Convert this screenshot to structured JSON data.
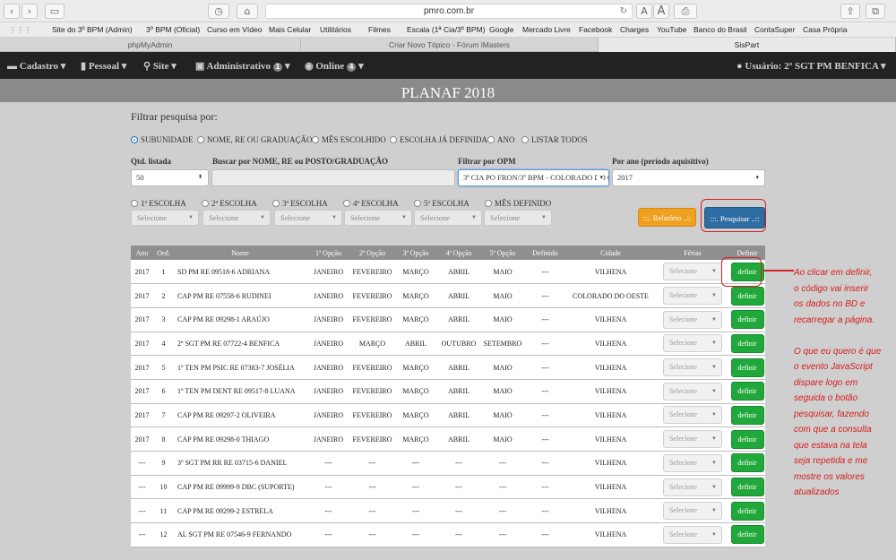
{
  "browser": {
    "url": "pmro.com.br",
    "reader_small": "A",
    "reader_large": "A",
    "bookmarks": [
      "Site do 3º BPM (Admin)",
      "3º BPM (Oficial)",
      "Curso em Vídeo",
      "Mais Celular",
      "Utilitários",
      "Filmes",
      "Escala (1ª Cia/3º BPM)",
      "Google",
      "Mercado Livre",
      "Facebook",
      "Charges",
      "YouTube",
      "Banco do Brasil",
      "ContaSuper",
      "Casa Própria"
    ],
    "tabs": [
      "phpMyAdmin",
      "Criar Novo Tópico - Fórum iMasters",
      "SisPart"
    ]
  },
  "nav": {
    "cadastro": "Cadastro",
    "pessoal": "Pessoal",
    "site": "Site",
    "administrativo": "Administrativo",
    "administrativo_badge": "1",
    "online": "Online",
    "online_badge": "4",
    "user": "Usuário: 2º SGT PM BENFICA"
  },
  "page": {
    "title": "PLANAF 2018",
    "filter_label": "Filtrar pesquisa por:",
    "radios": [
      "SUBUNIDADE",
      "NOME, RE OU GRADUAÇÃO",
      "MÊS ESCOLHIDO",
      "ESCOLHA JÁ DEFINIDA",
      "ANO",
      "LISTAR TODOS"
    ],
    "qtd_label": "Qtd. listada",
    "qtd_value": "50",
    "search_label": "Buscar por NOME, RE ou POSTO/GRADUAÇÃO",
    "opm_label": "Filtrar por OPM",
    "opm_value": "3ª CIA PO FRON/3º BPM - COLORADO DO OESTE",
    "ano_label": "Por ano (período aquisitivo)",
    "ano_value": "2017",
    "choices": [
      "1ª ESCOLHA",
      "2ª ESCOLHA",
      "3ª ESCOLHA",
      "4ª ESCOLHA",
      "5ª ESCOLHA",
      "MÊS DEFINIDO"
    ],
    "select_placeholder": "Selecione",
    "relatorio_btn": ":::. Relatório ..::",
    "pesquisar_btn": ":::. Pesquisar ..::"
  },
  "table": {
    "headers": [
      "Ano",
      "Ord.",
      "Nome",
      "1ª Opção",
      "2ª Opção",
      "3ª Opção",
      "4ª Opção",
      "5ª Opção",
      "Definido",
      "Cidade",
      "Férias",
      "Definir"
    ],
    "ferias_placeholder": "Selecione",
    "definir_label": "definir",
    "rows": [
      [
        "2017",
        "1",
        "SD PM RE 09518-6 ADRIANA",
        "JANEIRO",
        "FEVEREIRO",
        "MARÇO",
        "ABRIL",
        "MAIO",
        "---",
        "VILHENA"
      ],
      [
        "2017",
        "2",
        "CAP PM RE 07558-6 RUDINEI",
        "JANEIRO",
        "FEVEREIRO",
        "MARÇO",
        "ABRIL",
        "MAIO",
        "---",
        "COLORADO DO OESTE"
      ],
      [
        "2017",
        "3",
        "CAP PM RE 09298-1 ARAÚJO",
        "JANEIRO",
        "FEVEREIRO",
        "MARÇO",
        "ABRIL",
        "MAIO",
        "---",
        "VILHENA"
      ],
      [
        "2017",
        "4",
        "2º SGT PM RE 07722-4 BENFICA",
        "JANEIRO",
        "MARÇO",
        "ABRIL",
        "OUTUBRO",
        "SETEMBRO",
        "---",
        "VILHENA"
      ],
      [
        "2017",
        "5",
        "1º TEN PM PSIC RE 07383-7 JOSÉLIA",
        "JANEIRO",
        "FEVEREIRO",
        "MARÇO",
        "ABRIL",
        "MAIO",
        "---",
        "VILHENA"
      ],
      [
        "2017",
        "6",
        "1º TEN PM DENT RE 09517-8 LUANA",
        "JANEIRO",
        "FEVEREIRO",
        "MARÇO",
        "ABRIL",
        "MAIO",
        "---",
        "VILHENA"
      ],
      [
        "2017",
        "7",
        "CAP PM RE 09297-2 OLIVEIRA",
        "JANEIRO",
        "FEVEREIRO",
        "MARÇO",
        "ABRIL",
        "MAIO",
        "---",
        "VILHENA"
      ],
      [
        "2017",
        "8",
        "CAP PM RE 09298-0 THIAGO",
        "JANEIRO",
        "FEVEREIRO",
        "MARÇO",
        "ABRIL",
        "MAIO",
        "---",
        "VILHENA"
      ],
      [
        "---",
        "9",
        "3º SGT PM RR RE 03715-6 DANIEL",
        "---",
        "---",
        "---",
        "---",
        "---",
        "---",
        "VILHENA"
      ],
      [
        "---",
        "10",
        "CAP PM RE 09999-9 DBC (SUPORTE)",
        "---",
        "---",
        "---",
        "---",
        "---",
        "---",
        "VILHENA"
      ],
      [
        "---",
        "11",
        "CAP PM RE 09299-2 ESTRELA",
        "---",
        "---",
        "---",
        "---",
        "---",
        "---",
        "VILHENA"
      ],
      [
        "---",
        "12",
        "AL SGT PM RE 07546-9 FERNANDO",
        "---",
        "---",
        "---",
        "---",
        "---",
        "---",
        "VILHENA"
      ]
    ]
  },
  "annotation": {
    "lines": [
      "Ao clicar em definir,",
      "o código vai inserir",
      "os dados no BD e",
      "recarregar a página.",
      "",
      "O que eu quero é que",
      "o evento JavaScript",
      "dispare logo em",
      "seguida o botão",
      "pesquisar, fazendo",
      "com que a consulta",
      "que estava na tela",
      "seja repetida e me",
      "mostre os valores",
      "atualizados"
    ],
    "color": "#d61c1c"
  }
}
